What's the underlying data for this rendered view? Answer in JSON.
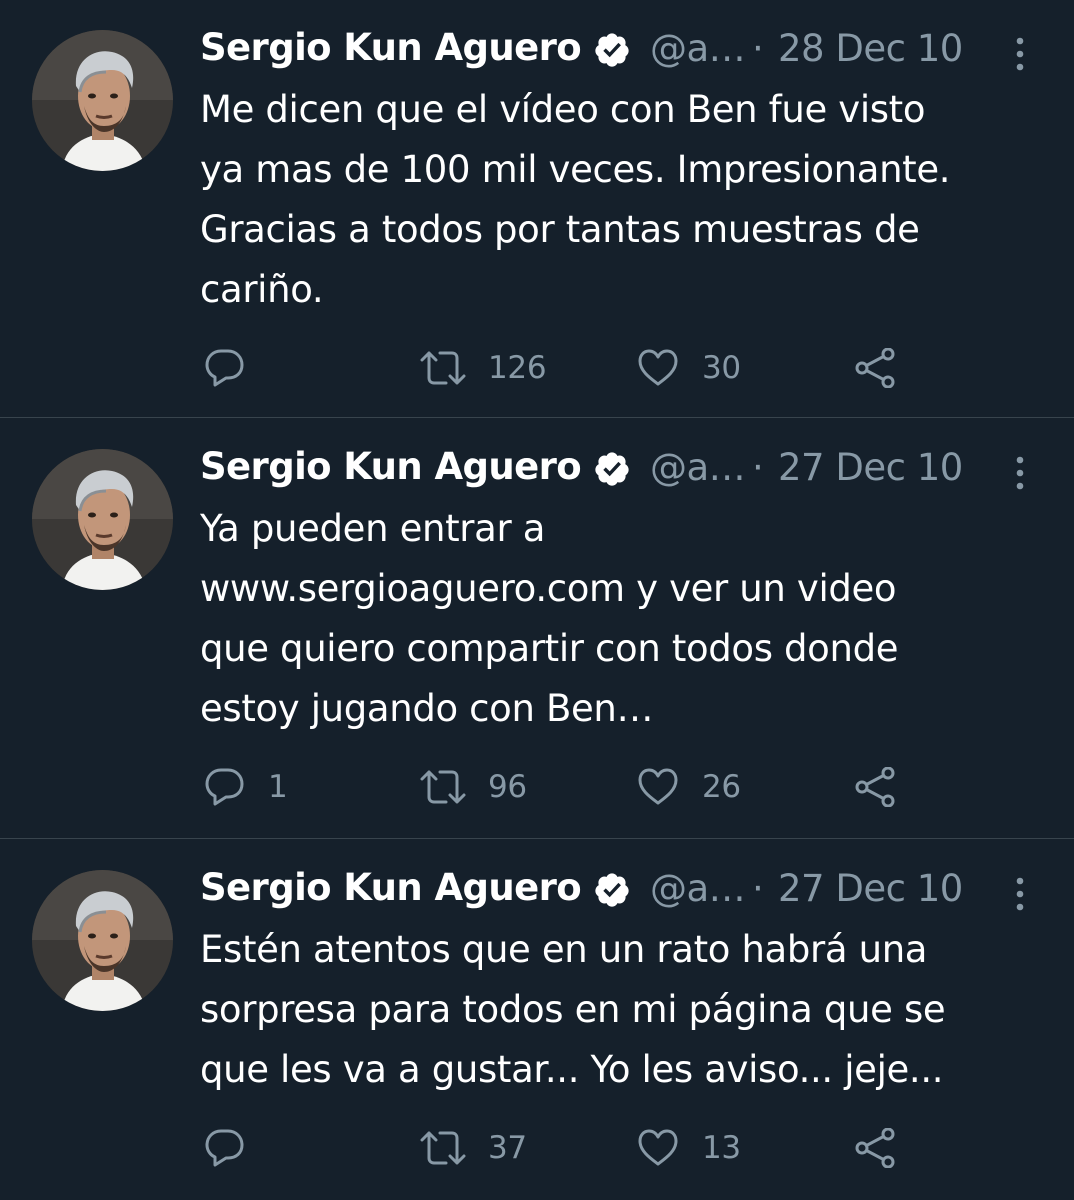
{
  "colors": {
    "background": "#15202b",
    "divider": "#38444d",
    "secondary_text": "#8899a6",
    "primary_text": "#ffffff",
    "verified_badge": "#ffffff"
  },
  "tweets": [
    {
      "author_name": "Sergio Kun Aguero",
      "handle": "@a…",
      "separator": "·",
      "date": "28 Dec 10",
      "text_lines": [
        "Me dicen que el vídeo con Ben fue visto",
        "ya mas de 100 mil veces. Impresionante.",
        "Gracias a todos por tantas muestras de",
        "cariño."
      ],
      "replies": "",
      "retweets": "126",
      "likes": "30"
    },
    {
      "author_name": "Sergio Kun Aguero",
      "handle": "@a…",
      "separator": "·",
      "date": "27 Dec 10",
      "text_lines": [
        "Ya pueden entrar a",
        "www.sergioaguero.com y ver un video",
        "que quiero compartir con todos donde",
        "estoy jugando con Ben…"
      ],
      "replies": "1",
      "retweets": "96",
      "likes": "26"
    },
    {
      "author_name": "Sergio Kun Aguero",
      "handle": "@a…",
      "separator": "·",
      "date": "27 Dec 10",
      "text_lines": [
        "Estén atentos que en un rato habrá una",
        "sorpresa para todos en mi página que se",
        "que les va a gustar... Yo les aviso... jeje..."
      ],
      "replies": "",
      "retweets": "37",
      "likes": "13"
    }
  ],
  "icons": {
    "verified": "verified-badge-icon",
    "more": "more-options-icon",
    "reply": "reply-icon",
    "retweet": "retweet-icon",
    "like": "heart-icon",
    "share": "share-icon"
  }
}
